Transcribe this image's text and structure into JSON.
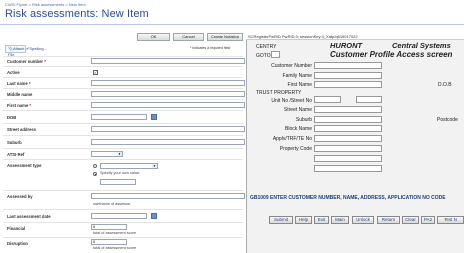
{
  "breadcrumb": {
    "root": "CWSI Flynet",
    "sep1": " > ",
    "section": "Risk assessments",
    "sep2": " > ",
    "current": "New Item"
  },
  "page_title": "Risk assessments: New Item",
  "toolbar": {
    "ok_label": "OK",
    "cancel_label": "Cancel",
    "notation_label": "Create Notation",
    "attach_label": "Attach File",
    "spelling_label": "Spelling...",
    "required_note": "indicates a required field",
    "required_star": "*"
  },
  "form": {
    "customer_number": {
      "label": "Customer number",
      "value": ""
    },
    "active": {
      "label": "Active",
      "checked": true
    },
    "last_name": {
      "label": "Last name",
      "value": ""
    },
    "middle_name": {
      "label": "Middle name",
      "value": ""
    },
    "first_name": {
      "label": "First name",
      "value": ""
    },
    "dob": {
      "label": "DOB",
      "value": ""
    },
    "street_address": {
      "label": "Street address",
      "value": ""
    },
    "suburb": {
      "label": "Suburb",
      "value": ""
    },
    "atsi_ref": {
      "label": "ATSI-Ref",
      "value": ""
    },
    "assessment_type": {
      "label": "Assessment type",
      "specify_label": "Specify your own value:"
    },
    "assessed_by": {
      "label": "Assessed by",
      "hint": "username of assessor"
    },
    "last_assessment_date": {
      "label": "Last assessment date",
      "value": ""
    },
    "financial": {
      "label": "Financial",
      "value": "0",
      "hint": "total of assessment score"
    },
    "disruption": {
      "label": "Disruption",
      "value": "0",
      "hint": "total of assessment score"
    }
  },
  "terminal": {
    "status_line": "SCRegisterPwRID PwRID:3; sessionKey:4_Xdtp/q619017022",
    "label_centry": "CENTRY",
    "label_goto": "GOTO",
    "heading_huront": "HURONT",
    "heading_central": "Central Systems",
    "heading_screen": "Customer Profile Access screen",
    "fields": {
      "customer_number": "Customer Number",
      "family_name": "Family Name",
      "first_name": "First Name",
      "dob": "D.O.B",
      "trust_property": "TRUST PROPERTY",
      "unit_street": "Unit No /Street No",
      "street_name": "Street Name",
      "suburb": "Suburb",
      "postcode": "Postcode",
      "block_name": "Block Name",
      "applv": "Applv/TRF/TE No",
      "property_code": "Property Code"
    },
    "message": "GB1009 ENTER CUSTOMER NUMBER, NAME, ADDRESS, APPLICATION NO CODE",
    "buttons": [
      "Submit",
      "Help",
      "Exit",
      "Main",
      "Unlock",
      "Return",
      "Clear",
      "PA2",
      "Test N"
    ]
  },
  "colors": {
    "title": "#2b4e8c",
    "message": "#1f3f7a",
    "required": "#cc0000"
  }
}
